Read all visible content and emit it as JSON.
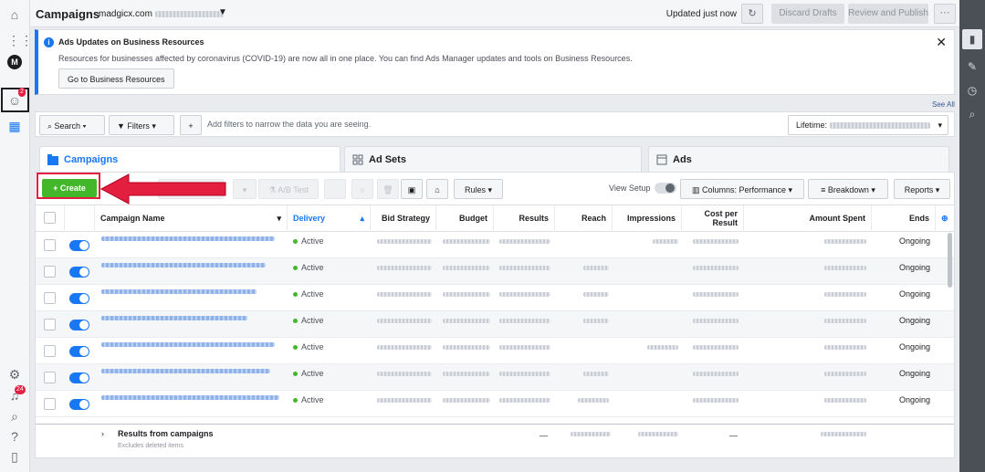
{
  "header": {
    "title": "Campaigns",
    "account": "madgicx.com",
    "updated": "Updated just now",
    "discard": "Discard Drafts",
    "review": "Review and Publish",
    "more": "···"
  },
  "leftnav": {
    "notif_count": "2",
    "alerts_count": "24"
  },
  "notice": {
    "title": "Ads Updates on Business Resources",
    "body": "Resources for businesses affected by coronavirus (COVID-19) are now all in one place. You can find Ads Manager updates and tools on Business Resources.",
    "button": "Go to Business Resources",
    "see_all": "See All"
  },
  "filters": {
    "search": "Search",
    "filters": "Filters",
    "hint": "Add filters to narrow the data you are seeing.",
    "lifetime": "Lifetime:"
  },
  "tabs": {
    "campaigns": "Campaigns",
    "adsets": "Ad Sets",
    "ads": "Ads"
  },
  "toolbar": {
    "create": "Create",
    "ab_test": "A/B Test",
    "rules": "Rules",
    "view_setup": "View Setup",
    "columns": "Columns: Performance",
    "breakdown": "Breakdown",
    "reports": "Reports"
  },
  "table": {
    "headers": {
      "name": "Campaign Name",
      "delivery": "Delivery",
      "bid": "Bid Strategy",
      "budget": "Budget",
      "results": "Results",
      "reach": "Reach",
      "impressions": "Impressions",
      "cpr": "Cost per Result",
      "spent": "Amount Spent",
      "ends": "Ends"
    },
    "rows": [
      {
        "delivery": "Active",
        "ends": "Ongoing"
      },
      {
        "delivery": "Active",
        "ends": "Ongoing"
      },
      {
        "delivery": "Active",
        "ends": "Ongoing"
      },
      {
        "delivery": "Active",
        "ends": "Ongoing"
      },
      {
        "delivery": "Active",
        "ends": "Ongoing"
      },
      {
        "delivery": "Active",
        "ends": "Ongoing"
      },
      {
        "delivery": "Active",
        "ends": "Ongoing"
      }
    ],
    "footer": {
      "title": "Results from campaigns",
      "sub": "Excludes deleted items",
      "results_dash": "—",
      "cpr_dash": "—"
    }
  },
  "colors": {
    "accent": "#1877f2",
    "create": "#42b72a",
    "highlight": "#e41e3f"
  }
}
